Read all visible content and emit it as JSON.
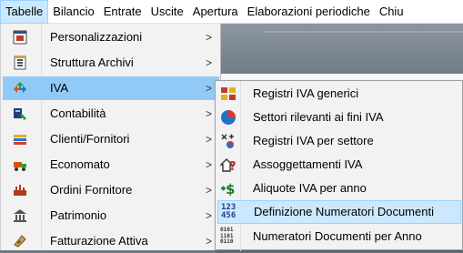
{
  "menubar": {
    "items": [
      {
        "label": "Tabelle",
        "active": true
      },
      {
        "label": "Bilancio"
      },
      {
        "label": "Entrate"
      },
      {
        "label": "Uscite"
      },
      {
        "label": "Apertura"
      },
      {
        "label": "Elaborazioni periodiche"
      },
      {
        "label": "Chiu"
      }
    ]
  },
  "menu": {
    "items": [
      {
        "label": "Personalizzazioni",
        "icon": "form-icon",
        "submenu": true
      },
      {
        "label": "Struttura Archivi",
        "icon": "archive-structure-icon",
        "submenu": true
      },
      {
        "label": "IVA",
        "icon": "recycle-arrows-icon",
        "submenu": true,
        "active": true
      },
      {
        "label": "Contabilità",
        "icon": "accounting-icon",
        "submenu": true
      },
      {
        "label": "Clienti/Fornitori",
        "icon": "clients-suppliers-icon",
        "submenu": true
      },
      {
        "label": "Economato",
        "icon": "truck-icon",
        "submenu": true
      },
      {
        "label": "Ordini Fornitore",
        "icon": "orders-icon",
        "submenu": true
      },
      {
        "label": "Patrimonio",
        "icon": "assets-icon",
        "submenu": true
      },
      {
        "label": "Fatturazione Attiva",
        "icon": "invoicing-icon",
        "submenu": true
      }
    ],
    "arrow": ">"
  },
  "submenu": {
    "items": [
      {
        "label": "Registri IVA generici",
        "icon": "registers-icon"
      },
      {
        "label": "Settori rilevanti ai fini IVA",
        "icon": "globe-icon"
      },
      {
        "label": "Registri IVA per settore",
        "icon": "sector-registers-icon"
      },
      {
        "label": "Assoggettamenti IVA",
        "icon": "question-icon"
      },
      {
        "label": "Aliquote IVA per anno",
        "icon": "dollar-icon"
      },
      {
        "label": "Definizione Numeratori Documenti",
        "icon": "numbering-icon",
        "highlighted": true
      },
      {
        "label": "Numeratori Documenti per Anno",
        "icon": "binary-numbers-icon"
      }
    ],
    "numbering_digits": [
      "123",
      "456"
    ],
    "binary_digits": [
      "0101",
      "1101",
      "0110"
    ]
  },
  "colors": {
    "menu_bg": "#f2f2f2",
    "active_row": "#91c9f7",
    "hover_row": "#cce8ff",
    "hover_border": "#99d1ff"
  }
}
